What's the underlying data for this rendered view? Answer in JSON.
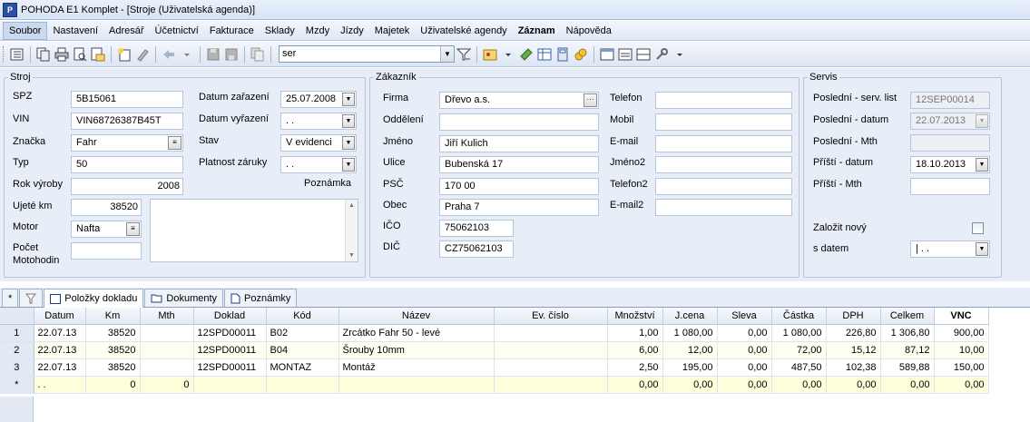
{
  "window": {
    "title": "POHODA E1 Komplet - [Stroje (Uživatelská agenda)]",
    "icon_text": "P"
  },
  "menu": [
    "Soubor",
    "Nastavení",
    "Adresář",
    "Účetnictví",
    "Fakturace",
    "Sklady",
    "Mzdy",
    "Jízdy",
    "Majetek",
    "Uživatelské agendy",
    "Záznam",
    "Nápověda"
  ],
  "toolbar": {
    "search_value": "ser"
  },
  "stroj": {
    "legend": "Stroj",
    "spz_label": "SPZ",
    "spz": "5B15061",
    "vin_label": "VIN",
    "vin": "VIN68726387B45T",
    "znacka_label": "Značka",
    "znacka": "Fahr",
    "typ_label": "Typ",
    "typ": "50",
    "rok_label": "Rok výroby",
    "rok": "2008",
    "km_label": "Ujeté km",
    "km": "38520",
    "motor_label": "Motor",
    "motor": "Nafta",
    "motohodin_label_1": "Počet",
    "motohodin_label_2": "Motohodin",
    "motohodin": "",
    "datum_zarazeni_label": "Datum zařazení",
    "datum_zarazeni": "25.07.2008",
    "datum_vyrazeni_label": "Datum vyřazení",
    "datum_vyrazeni": " .  .",
    "stav_label": "Stav",
    "stav": "V evidenci",
    "zaruka_label": "Platnost záruky",
    "zaruka": " .  .",
    "poznamka_label": "Poznámka"
  },
  "zakaznik": {
    "legend": "Zákazník",
    "firma_label": "Firma",
    "firma": "Dřevo a.s.",
    "oddeleni_label": "Oddělení",
    "oddeleni": "",
    "jmeno_label": "Jméno",
    "jmeno": "Jiří Kulich",
    "ulice_label": "Ulice",
    "ulice": "Bubenská 17",
    "psc_label": "PSČ",
    "psc": "170 00",
    "obec_label": "Obec",
    "obec": "Praha 7",
    "ico_label": "IČO",
    "ico": "75062103",
    "dic_label": "DIČ",
    "dic": "CZ75062103",
    "telefon_label": "Telefon",
    "telefon": "",
    "mobil_label": "Mobil",
    "mobil": "",
    "email_label": "E-mail",
    "email": "",
    "jmeno2_label": "Jméno2",
    "jmeno2": "",
    "telefon2_label": "Telefon2",
    "telefon2": "",
    "email2_label": "E-mail2",
    "email2": ""
  },
  "servis": {
    "legend": "Servis",
    "posl_list_label": "Poslední - serv. list",
    "posl_list": "12SEP00014",
    "posl_datum_label": "Poslední - datum",
    "posl_datum": "22.07.2013",
    "posl_mth_label": "Poslední - Mth",
    "posl_mth": "",
    "pristi_datum_label": "Příští - datum",
    "pristi_datum": "18.10.2013",
    "pristi_mth_label": "Příští - Mth",
    "pristi_mth": "",
    "zalozit_label": "Založit nový",
    "s_datem_label": "s datem",
    "s_datem": "|  .  ."
  },
  "tabs": [
    {
      "label": "*"
    },
    {
      "label": ""
    },
    {
      "label": "Položky dokladu"
    },
    {
      "label": "Dokumenty"
    },
    {
      "label": "Poznámky"
    }
  ],
  "grid": {
    "columns": [
      "Datum",
      "Km",
      "Mth",
      "Doklad",
      "Kód",
      "Název",
      "Ev. číslo",
      "Množství",
      "J.cena",
      "Sleva",
      "Částka",
      "DPH",
      "Celkem",
      "VNC"
    ],
    "rows": [
      {
        "hdr": "1",
        "cells": [
          "22.07.13",
          "38520",
          "",
          "12SPD00011",
          "B02",
          "Zrcátko Fahr 50 - levé",
          "",
          "1,00",
          "1 080,00",
          "0,00",
          "1 080,00",
          "226,80",
          "1 306,80",
          "900,00"
        ]
      },
      {
        "hdr": "2",
        "cells": [
          "22.07.13",
          "38520",
          "",
          "12SPD00011",
          "B04",
          "Šrouby 10mm",
          "",
          "6,00",
          "12,00",
          "0,00",
          "72,00",
          "15,12",
          "87,12",
          "10,00"
        ]
      },
      {
        "hdr": "3",
        "cells": [
          "22.07.13",
          "38520",
          "",
          "12SPD00011",
          "MONTAZ",
          "Montáž",
          "",
          "2,50",
          "195,00",
          "0,00",
          "487,50",
          "102,38",
          "589,88",
          "150,00"
        ]
      },
      {
        "hdr": "*",
        "cells": [
          " .  .",
          "0",
          "0",
          "",
          "",
          "",
          "",
          "0,00",
          "0,00",
          "0,00",
          "0,00",
          "0,00",
          "0,00",
          "0,00"
        ]
      }
    ]
  }
}
